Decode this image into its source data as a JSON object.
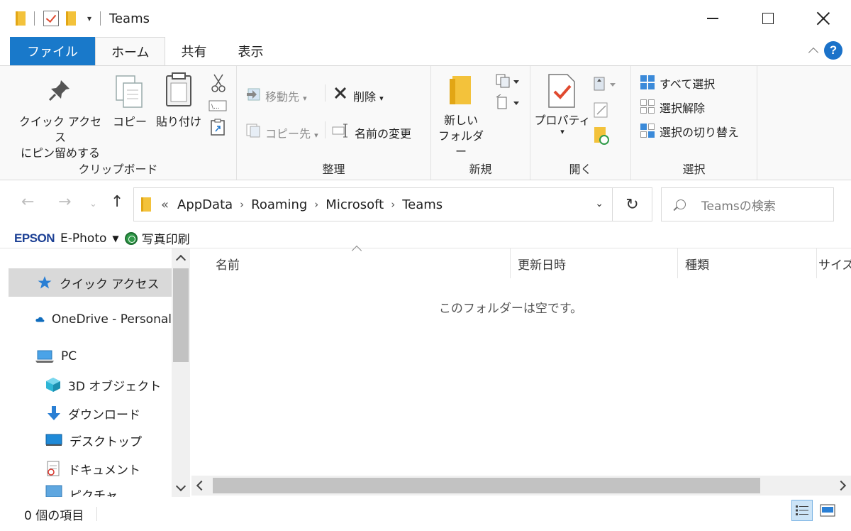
{
  "window": {
    "title": "Teams",
    "qat_dropdown": "▾"
  },
  "tabs": [
    {
      "label": "ファイル"
    },
    {
      "label": "ホーム"
    },
    {
      "label": "共有"
    },
    {
      "label": "表示"
    }
  ],
  "ribbon": {
    "clipboard": {
      "group": "クリップボード",
      "pin_line1": "クイック アクセス",
      "pin_line2": "にピン留めする",
      "copy": "コピー",
      "paste": "貼り付け"
    },
    "organize": {
      "group": "整理",
      "move_to": "移動先",
      "delete": "削除",
      "copy_to": "コピー先",
      "rename": "名前の変更"
    },
    "new": {
      "group": "新規",
      "new_folder_line1": "新しい",
      "new_folder_line2": "フォルダー"
    },
    "open": {
      "group": "開く",
      "properties": "プロパティ"
    },
    "select": {
      "group": "選択",
      "select_all": "すべて選択",
      "select_none": "選択解除",
      "invert": "選択の切り替え"
    }
  },
  "address": {
    "overflow": "«",
    "crumbs": [
      "AppData",
      "Roaming",
      "Microsoft",
      "Teams"
    ],
    "search_placeholder": "Teamsの検索"
  },
  "epson": {
    "brand": "EPSON",
    "app": "E-Photo",
    "print": "写真印刷"
  },
  "nav": {
    "items": [
      {
        "label": "クイック アクセス",
        "icon": "star-pin-icon"
      },
      {
        "label": "OneDrive - Personal",
        "icon": "cloud-icon"
      },
      {
        "label": "PC",
        "icon": "pc-icon"
      },
      {
        "label": "3D オブジェクト",
        "icon": "cube-icon"
      },
      {
        "label": "ダウンロード",
        "icon": "download-arrow-icon"
      },
      {
        "label": "デスクトップ",
        "icon": "desktop-icon"
      },
      {
        "label": "ドキュメント",
        "icon": "document-icon"
      },
      {
        "label": "ピクチャ",
        "icon": "picture-icon"
      }
    ]
  },
  "content": {
    "columns": [
      "名前",
      "更新日時",
      "種類",
      "サイズ"
    ],
    "empty_message": "このフォルダーは空です。"
  },
  "status": {
    "item_count": "0 個の項目"
  },
  "colors": {
    "accent": "#1979ca",
    "folder": "#f3c23b",
    "epson_brand": "#1b3f94"
  }
}
